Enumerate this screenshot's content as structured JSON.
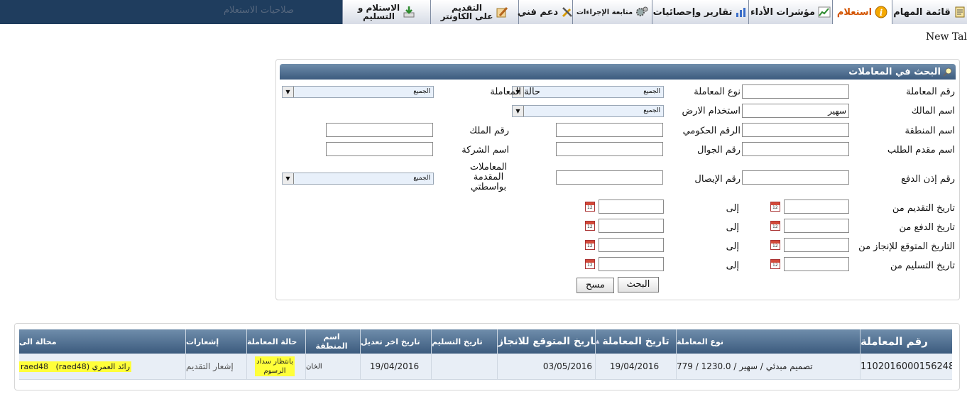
{
  "nav": {
    "tabs": [
      {
        "label": "قائمة المهام",
        "icon": "checklist-icon"
      },
      {
        "label": "استعلام",
        "icon": "info-icon",
        "active": true
      },
      {
        "label": "مؤشرات الأداء",
        "icon": "trend-chart-icon"
      },
      {
        "label": "تقارير وإحصائيات",
        "icon": "bar-chart-icon"
      },
      {
        "label": "متابعة الإجراءات",
        "icon": "gears-icon"
      },
      {
        "label": "دعم فني",
        "icon": "tools-icon"
      },
      {
        "label_line1": "التقديم",
        "label_line2": "على الكاونتر",
        "icon": "pen-paper-icon"
      },
      {
        "label_line1": "الاستلام و",
        "label_line2": "التسليم",
        "icon": "download-tray-icon"
      }
    ],
    "disabled_tab": "صلاحيات الاستعلام",
    "new_tab": "New Tal"
  },
  "search": {
    "title": "البحث في المعاملات",
    "labels": {
      "transaction_no": "رقم المعاملة",
      "transaction_type": "نوع المعاملة",
      "transaction_status": "حالة المعاملة",
      "owner_name": "اسم المالك",
      "land_use": "استخدام الارض",
      "region_name": "اسم المنطقة",
      "gov_no": "الرقم الحكومي",
      "property_no": "رقم الملك",
      "applicant_name": "اسم مقدم الطلب",
      "mobile_no": "رقم الجوال",
      "company_name": "اسم الشركة",
      "payment_order_no": "رقم إذن الدفع",
      "receipt_no": "رقم الإيصال",
      "submitted_by_me": "المعاملات المقدمة بواسطتي",
      "submit_date_from": "تاريخ التقديم من",
      "pay_date_from": "تاريخ الدفع من",
      "expected_date_from": "التاريخ المتوقع للإنجاز من",
      "delivery_date_from": "تاريخ التسليم من",
      "to": "إلى"
    },
    "values": {
      "owner_name": "سهير",
      "all": "الجميع"
    },
    "buttons": {
      "search": "البحث",
      "clear": "مسح"
    }
  },
  "results": {
    "columns": [
      {
        "label": "رقم المعاملة"
      },
      {
        "label": "نوع المعاملة"
      },
      {
        "label": "تاريخ المعاملة"
      },
      {
        "label": "التاريخ المتوقع للانجاز"
      },
      {
        "label": "تاريخ التسليم"
      },
      {
        "label": "تاريخ اخر تعديل"
      },
      {
        "label_line1": "اسم",
        "label_line2": "المنطقة"
      },
      {
        "label": "حالة المعاملة"
      },
      {
        "label": "إشعارات"
      },
      {
        "label": "محالة الى"
      }
    ],
    "rows": [
      {
        "transaction_no": "110201600015624 8",
        "transaction_no_display": "1102016000156248",
        "transaction_type": "تصميم مبدئي / سهير / 1230.0 / 779",
        "transaction_date": "19/04/2016",
        "expected_date": "03/05/2016",
        "delivery_date": "",
        "last_modified": "19/04/2016",
        "region": "الخان",
        "status_line1": "بانتظار سداد",
        "status_line2": "الرسوم",
        "notifications": "إشعار التقديم",
        "assigned_to": "رائد العمري (raed48)   raed48"
      }
    ]
  }
}
